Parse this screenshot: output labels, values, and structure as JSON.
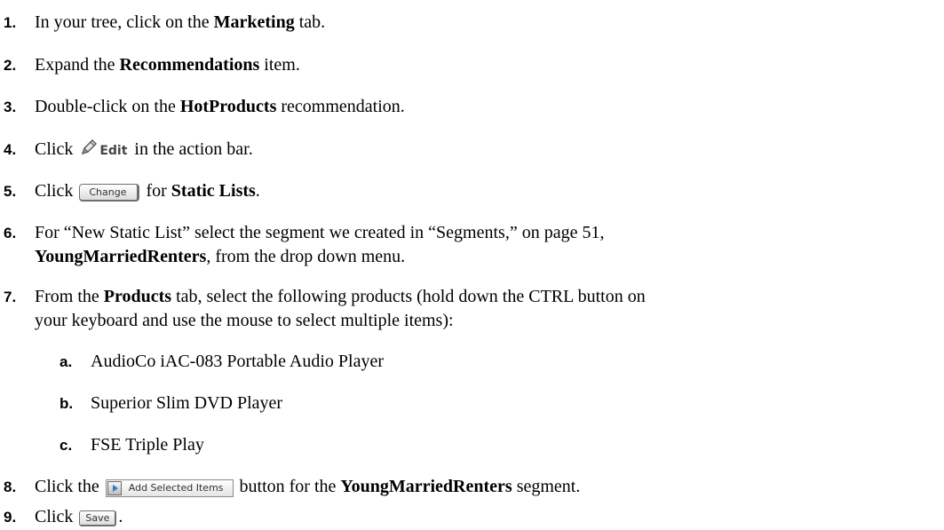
{
  "steps": [
    {
      "num": "1.",
      "pre": "In your tree, click on the ",
      "kw": "Marketing",
      "post": " tab."
    },
    {
      "num": "2.",
      "pre": "Expand the ",
      "kw": "Recommendations",
      "post": " item."
    },
    {
      "num": "3.",
      "pre": "Double-click on the ",
      "kw": "HotProducts",
      "post": " recommendation."
    },
    {
      "num": "4.",
      "pre": "Click ",
      "icon": "pencil-icon",
      "edit_label": "Edit",
      "post": " in the action bar."
    },
    {
      "num": "5.",
      "pre": "Click ",
      "button": "Change",
      "mid": " for ",
      "kw": "Static Lists",
      "post": "."
    },
    {
      "num": "6.",
      "line1": "For “New Static List” select the segment we created in “Segments,” on page 51,",
      "kw": "YoungMarriedRenters",
      "post": ", from the drop down menu."
    },
    {
      "num": "7.",
      "pre": "From the ",
      "kw": "Products",
      "post": " tab, select the following products (hold down the CTRL button on",
      "line2": "your keyboard and use the mouse to select multiple items):"
    },
    {
      "num": "8.",
      "pre": "Click the ",
      "button": "Add Selected Items",
      "icon": "right-arrow-icon",
      "mid": " button for the ",
      "kw": "YoungMarriedRenters",
      "post": " segment."
    },
    {
      "num": "9.",
      "pre": "Click ",
      "button": "Save",
      "post": "."
    }
  ],
  "substeps": [
    {
      "num": "a.",
      "text": "AudioCo iAC-083 Portable Audio Player"
    },
    {
      "num": "b.",
      "text": "Superior Slim DVD Player"
    },
    {
      "num": "c.",
      "text": "FSE Triple Play"
    }
  ]
}
